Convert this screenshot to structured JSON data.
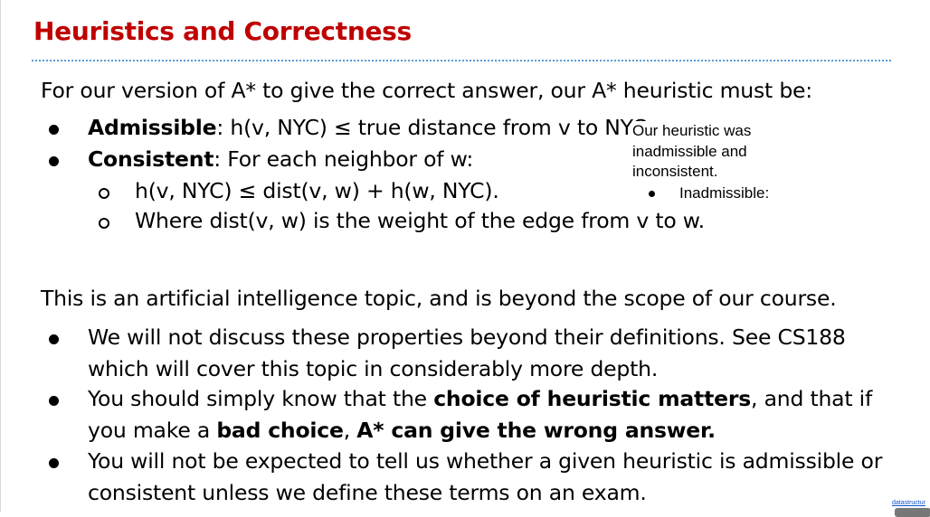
{
  "title": "Heuristics and Correctness",
  "intro": "For our version of A* to give the correct answer, our A* heuristic must be:",
  "admissible": {
    "term": "Admissible",
    "text": ": h(v, NYC) ≤ true distance from v to NYC."
  },
  "consistent": {
    "term": "Consistent",
    "text": ": For each neighbor of w:"
  },
  "sub_items": [
    "h(v, NYC) ≤ dist(v, w) + h(w, NYC).",
    "Where dist(v, w) is the weight of the edge from v to w."
  ],
  "note": {
    "line1": "Our heuristic was",
    "line2": "inadmissible and",
    "line3": "inconsistent.",
    "item": "Inadmissible:"
  },
  "second_para": "This is an artificial intelligence topic, and is beyond the scope of our course.",
  "bullets": {
    "b1_line1": "We will not discuss these properties beyond their definitions. See CS188",
    "b1_line2": "which will cover this topic in considerably more depth.",
    "b2_pre": "You should simply know that the ",
    "b2_bold": "choice of heuristic matters",
    "b2_post": ", and that if",
    "b2_line2_pre": "you make a ",
    "b2_line2_bold1": "bad choice",
    "b2_line2_mid": ", ",
    "b2_line2_bold2": "A* can give the wrong answer.",
    "b3_line1": "You will not be expected to tell us whether a given heuristic is admissible or",
    "b3_line2": "consistent unless we define these terms on an exam."
  },
  "footer": "datastructur"
}
